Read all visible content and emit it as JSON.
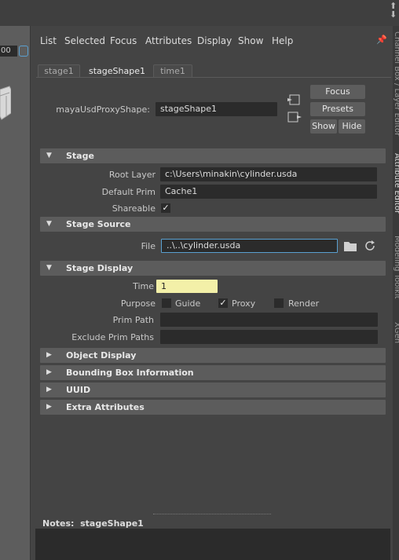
{
  "left_panel": {
    "value_field": "00"
  },
  "menu": [
    "List",
    "Selected",
    "Focus",
    "Attributes",
    "Display",
    "Show",
    "Help"
  ],
  "tabs": [
    {
      "label": "stage1",
      "active": false
    },
    {
      "label": "stageShape1",
      "active": true
    },
    {
      "label": "time1",
      "active": false
    }
  ],
  "header": {
    "node_type_label": "mayaUsdProxyShape:",
    "node_name": "stageShape1",
    "focus_button": "Focus",
    "presets_button": "Presets",
    "show_button": "Show",
    "hide_button": "Hide"
  },
  "sections": {
    "stage": {
      "title": "Stage",
      "root_layer_label": "Root Layer",
      "root_layer_value": "c:\\Users\\minakin\\cylinder.usda",
      "default_prim_label": "Default Prim",
      "default_prim_value": "Cache1",
      "shareable_label": "Shareable",
      "shareable_checked": true
    },
    "stage_source": {
      "title": "Stage Source",
      "file_label": "File",
      "file_value": "..\\..\\cylinder.usda"
    },
    "stage_display": {
      "title": "Stage Display",
      "time_label": "Time",
      "time_value": "1",
      "purpose_label": "Purpose",
      "purpose_options": [
        {
          "label": "Guide",
          "checked": false
        },
        {
          "label": "Proxy",
          "checked": true
        },
        {
          "label": "Render",
          "checked": false
        }
      ],
      "prim_path_label": "Prim Path",
      "prim_path_value": "",
      "exclude_prim_paths_label": "Exclude Prim Paths",
      "exclude_prim_paths_value": ""
    },
    "collapsed": [
      "Object Display",
      "Bounding Box Information",
      "UUID",
      "Extra Attributes"
    ]
  },
  "notes": {
    "label": "Notes:",
    "node_name": "stageShape1"
  },
  "colors": {
    "panel": "#444444",
    "field": "#2b2b2b",
    "section": "#5c5c5c",
    "time_field": "#f3f0a8",
    "focus_border": "#5aa0d0"
  }
}
